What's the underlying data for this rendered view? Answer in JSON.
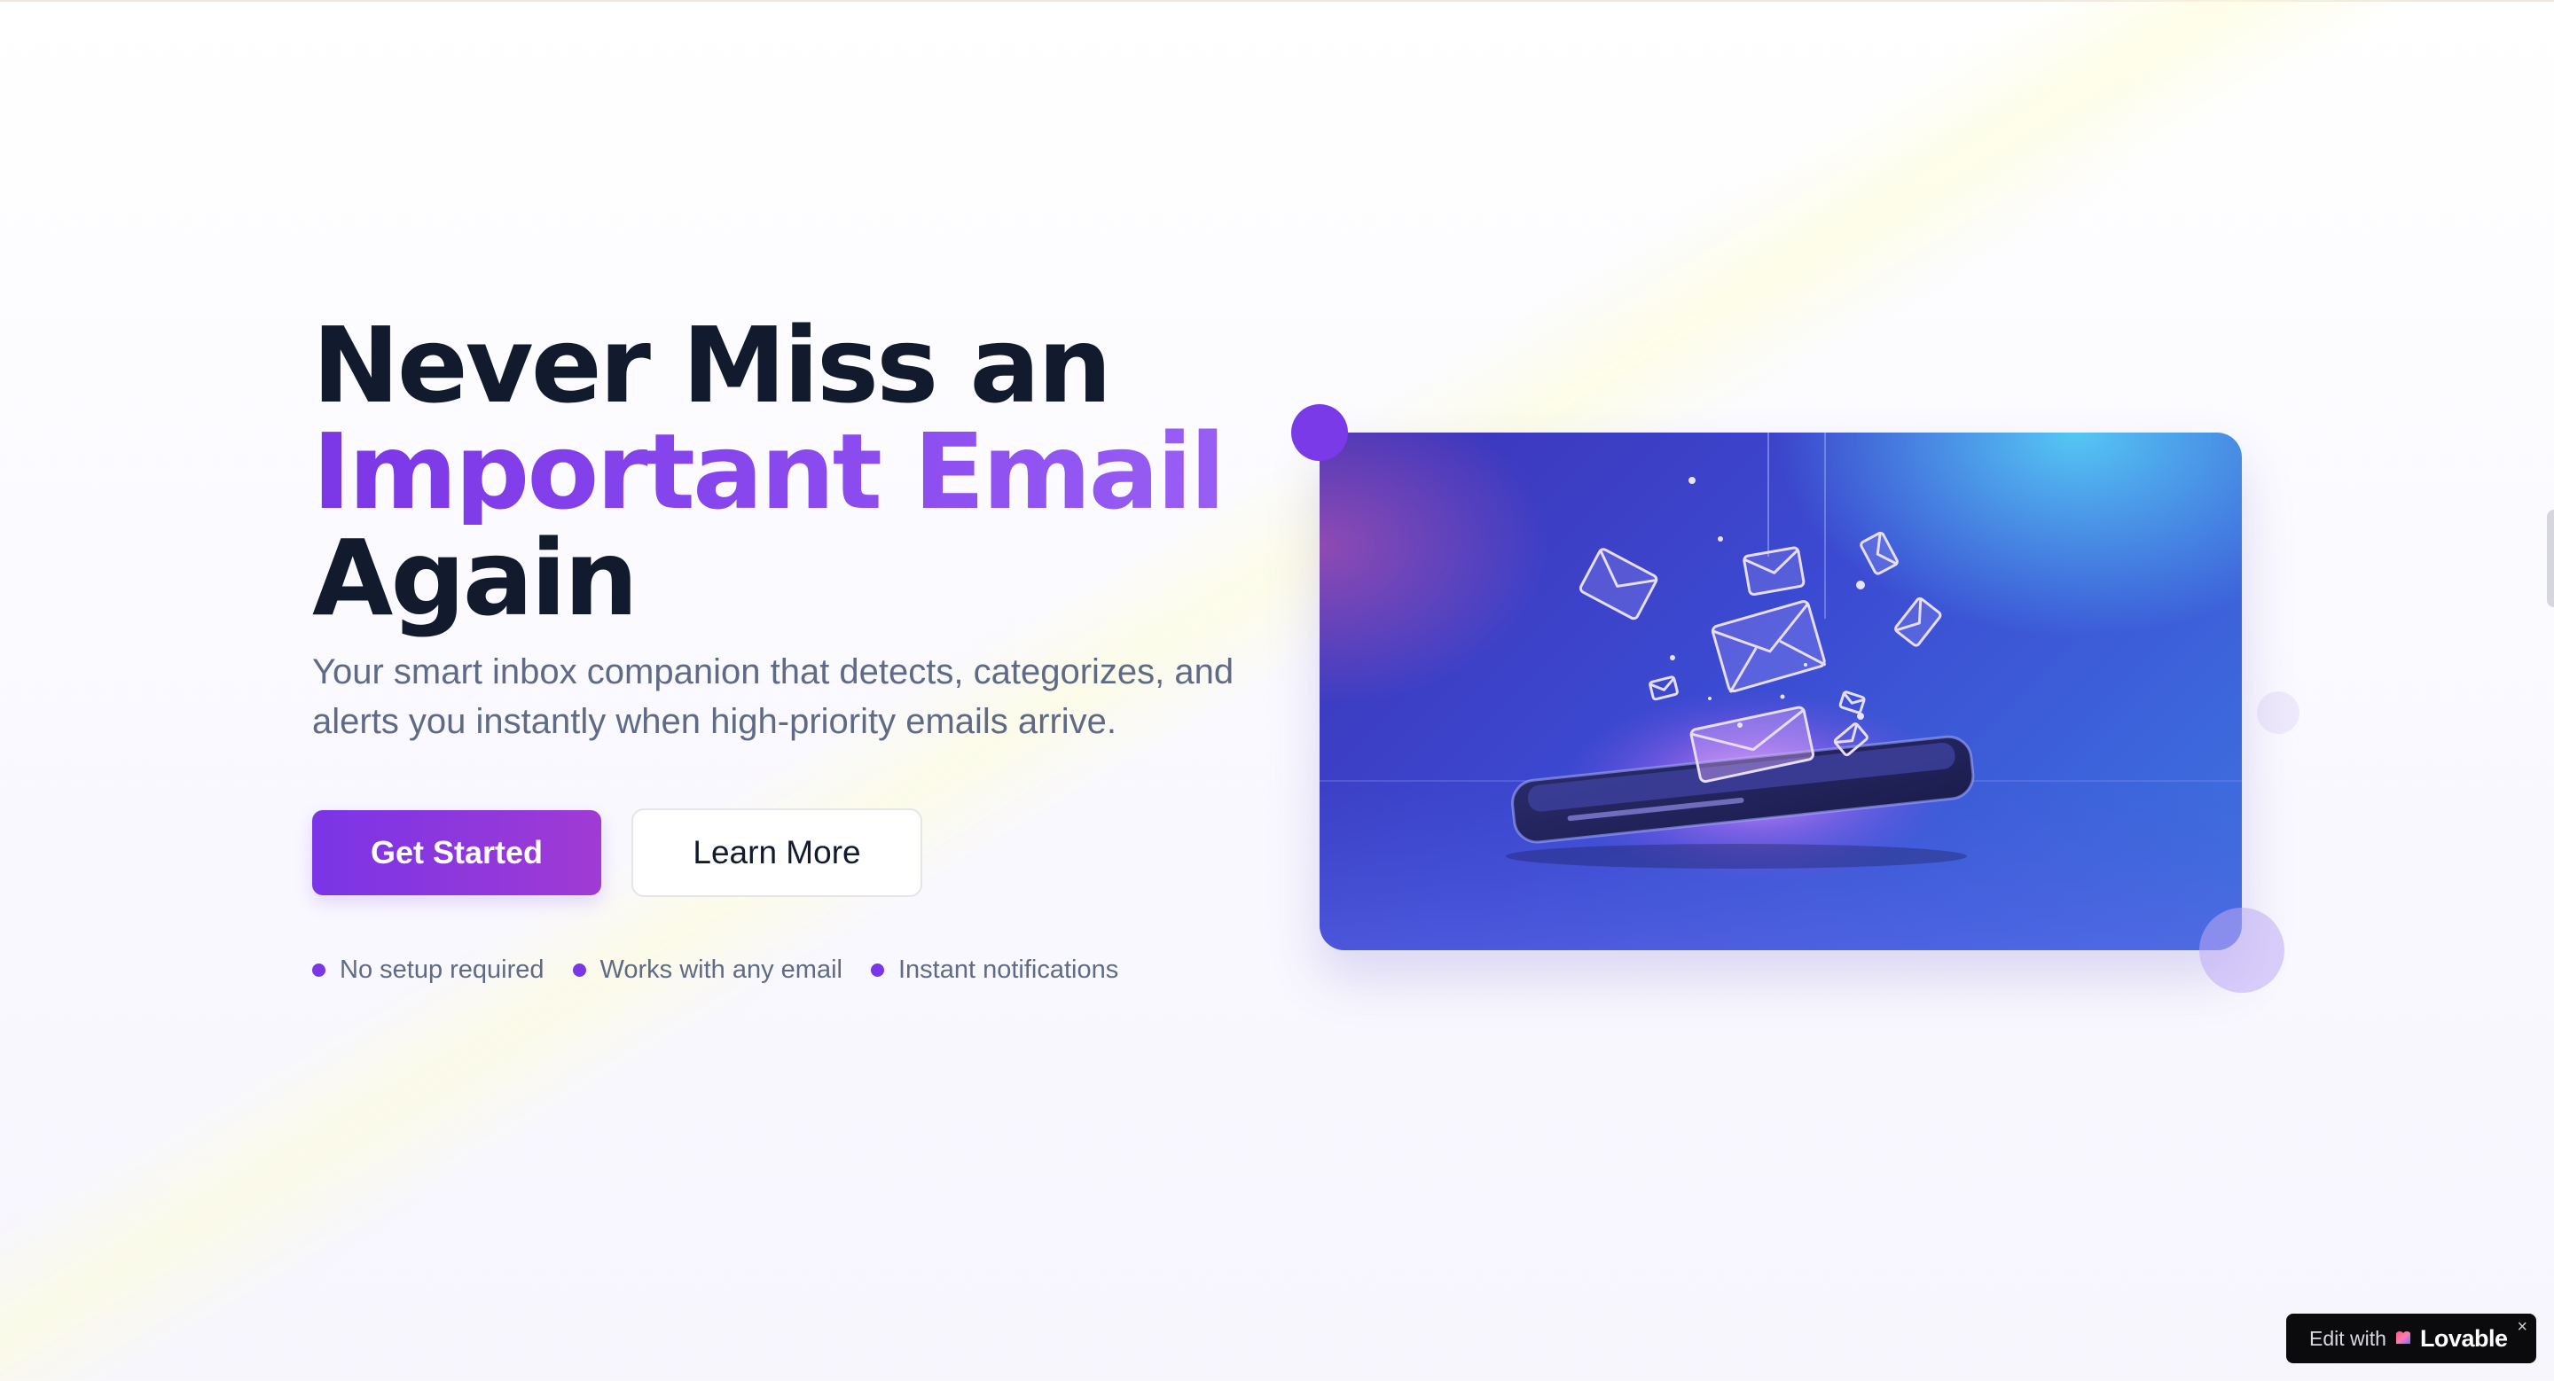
{
  "hero": {
    "headline": {
      "line1": "Never Miss an",
      "line2": "Important Email",
      "line3": "Again"
    },
    "subtitle": "Your smart inbox companion that detects, categorizes, and alerts you instantly when high-priority emails arrive.",
    "primary_cta": "Get Started",
    "secondary_cta": "Learn More",
    "features": [
      "No setup required",
      "Works with any email",
      "Instant notifications"
    ],
    "image_icon": "phone-with-floating-envelopes-illustration"
  },
  "badge": {
    "edit_label": "Edit with",
    "brand": "Lovable",
    "close": "×"
  },
  "colors": {
    "accent": "#7b36e6",
    "heading": "#121a2e",
    "muted": "#5f6b86"
  }
}
